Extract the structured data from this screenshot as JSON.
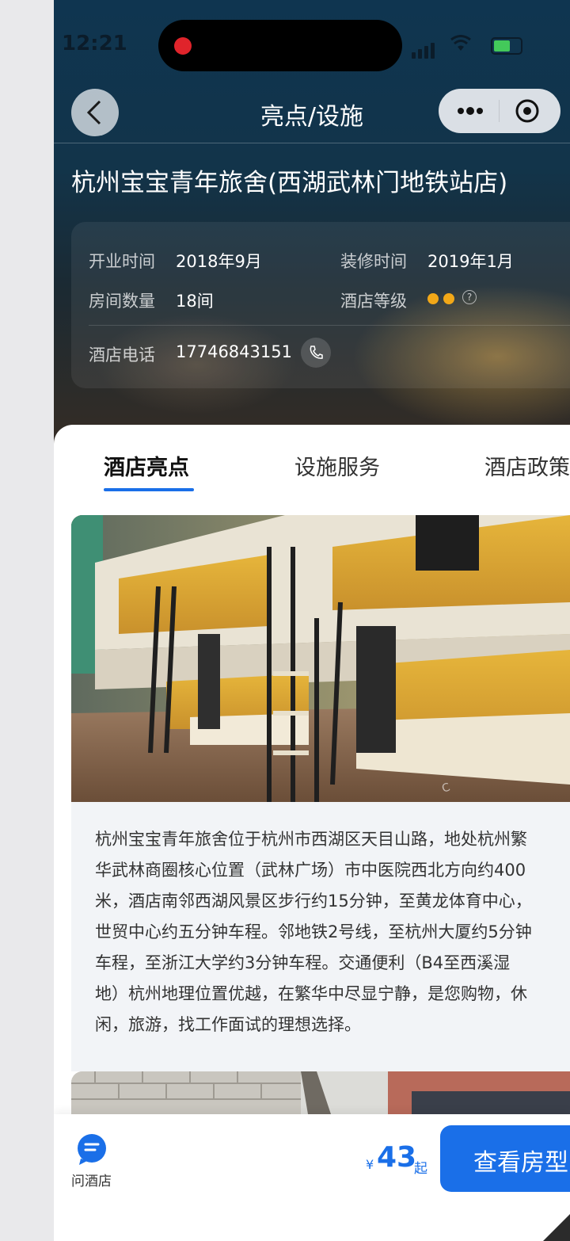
{
  "status_bar": {
    "time": "12:21"
  },
  "nav": {
    "title": "亮点/设施"
  },
  "hotel": {
    "name": "杭州宝宝青年旅舍(西湖武林门地铁站店)",
    "opening_label": "开业时间",
    "opening_value": "2018年9月",
    "renovation_label": "装修时间",
    "renovation_value": "2019年1月",
    "rooms_label": "房间数量",
    "rooms_value": "18间",
    "level_label": "酒店等级",
    "level_value": 2,
    "phone_label": "酒店电话",
    "phone_value": "17746843151"
  },
  "tabs": [
    {
      "label": "酒店亮点",
      "active": true
    },
    {
      "label": "设施服务",
      "active": false
    },
    {
      "label": "酒店政策",
      "active": false
    }
  ],
  "description_lines": [
    "杭州宝宝青年旅舍位于杭州市西湖区天目山路，地处杭州繁",
    "华武林商圈核心位置（武林广场）市中医院西北方向约400",
    "米，酒店南邻西湖风景区步行约15分钟，至黄龙体育中心，",
    "世贸中心约五分钟车程。邻地铁2号线，至杭州大厦约5分钟",
    "车程，至浙江大学约3分钟车程。交通便利（B4至西溪湿",
    "地）杭州地理位置优越，在繁华中尽显宁静，是您购物，休",
    "闲，旅游，找工作面试的理想选择。"
  ],
  "bottom_bar": {
    "ask_label": "问酒店",
    "price_symbol": "¥",
    "price": "43",
    "price_suffix": "起",
    "cta_label": "查看房型"
  },
  "colors": {
    "accent": "#1a6fe8",
    "star": "#f2a818"
  }
}
